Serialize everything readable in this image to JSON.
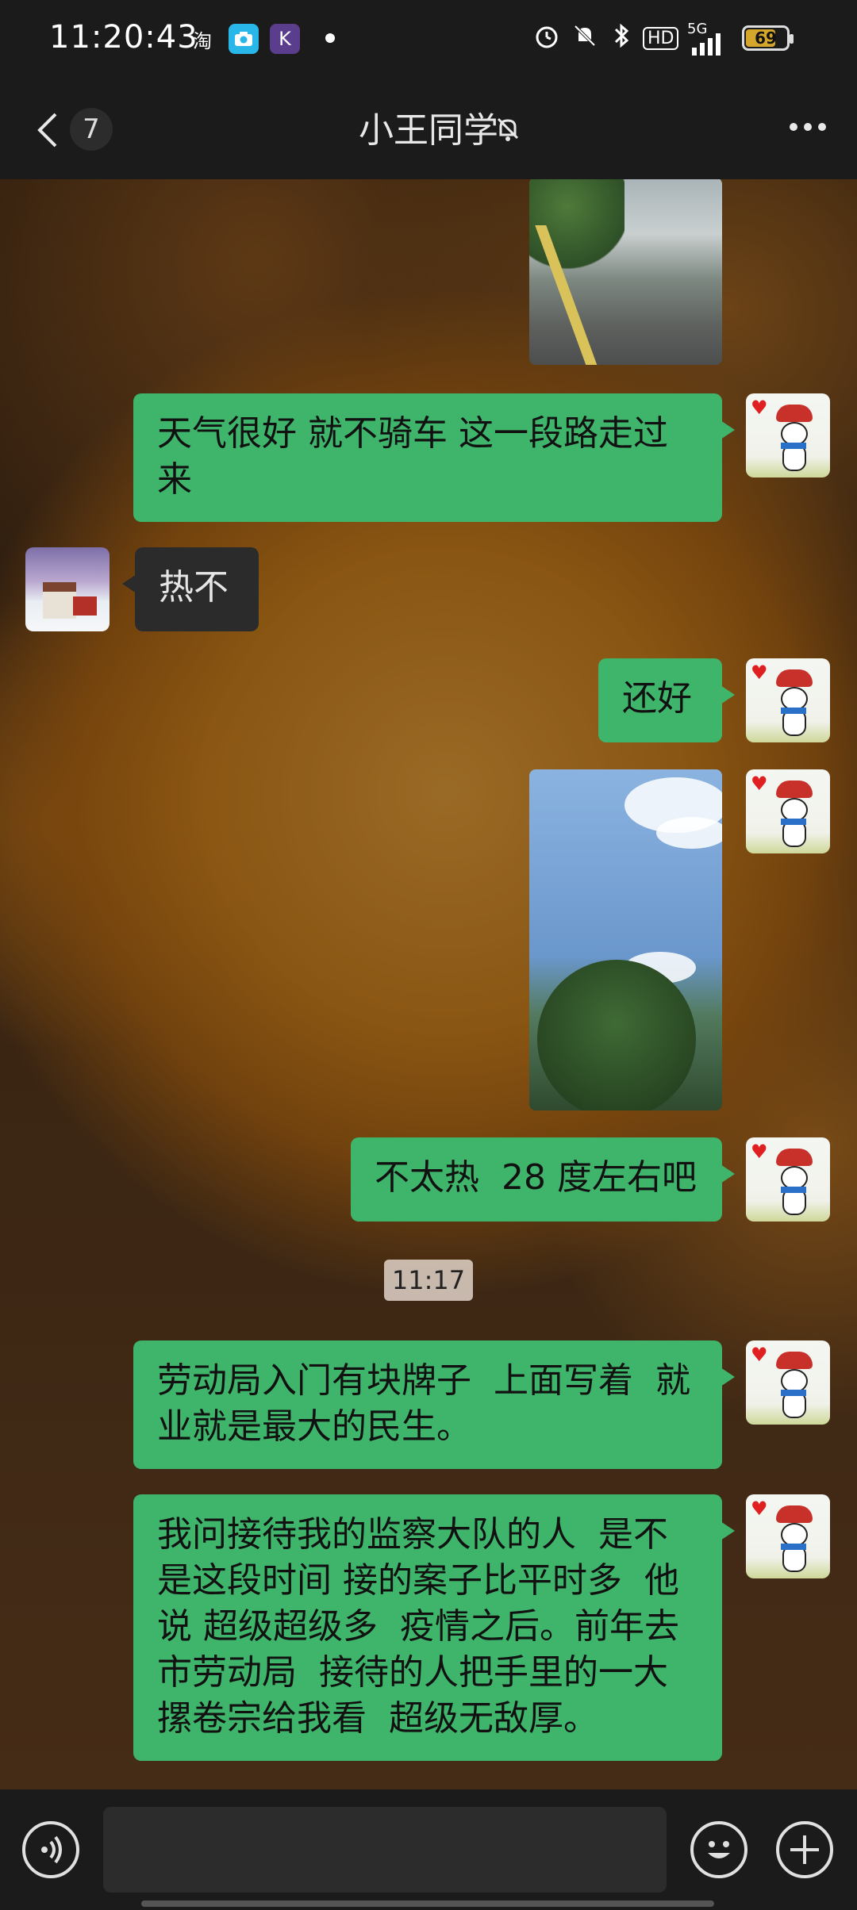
{
  "status_bar": {
    "time": "11:20:43",
    "app_icons": [
      "淘",
      "camera-icon",
      "K"
    ],
    "network": "5G",
    "hd": "HD",
    "battery_level": "69"
  },
  "header": {
    "back_count": "7",
    "title": "小王同学"
  },
  "messages": [
    {
      "from": "me",
      "type": "image",
      "icon": "photo-road"
    },
    {
      "from": "me",
      "type": "text",
      "text": "天气很好 就不骑车 这一段路走过来"
    },
    {
      "from": "other",
      "type": "text",
      "text": "热不"
    },
    {
      "from": "me",
      "type": "text",
      "text": "还好"
    },
    {
      "from": "me",
      "type": "image",
      "icon": "photo-sky"
    },
    {
      "from": "me",
      "type": "text",
      "text": "不太热  28 度左右吧"
    },
    {
      "from": "system",
      "type": "time",
      "text": "11:17"
    },
    {
      "from": "me",
      "type": "text",
      "text": "劳动局入门有块牌子  上面写着  就业就是最大的民生。"
    },
    {
      "from": "me",
      "type": "text",
      "text": "我问接待我的监察大队的人  是不是这段时间 接的案子比平时多  他说 超级超级多  疫情之后。前年去市劳动局  接待的人把手里的一大摞卷宗给我看  超级无敌厚。"
    }
  ],
  "colors": {
    "bubble_me": "#3fb46b",
    "bubble_other": "#2b2b2b",
    "bar": "#1b1b1b"
  }
}
